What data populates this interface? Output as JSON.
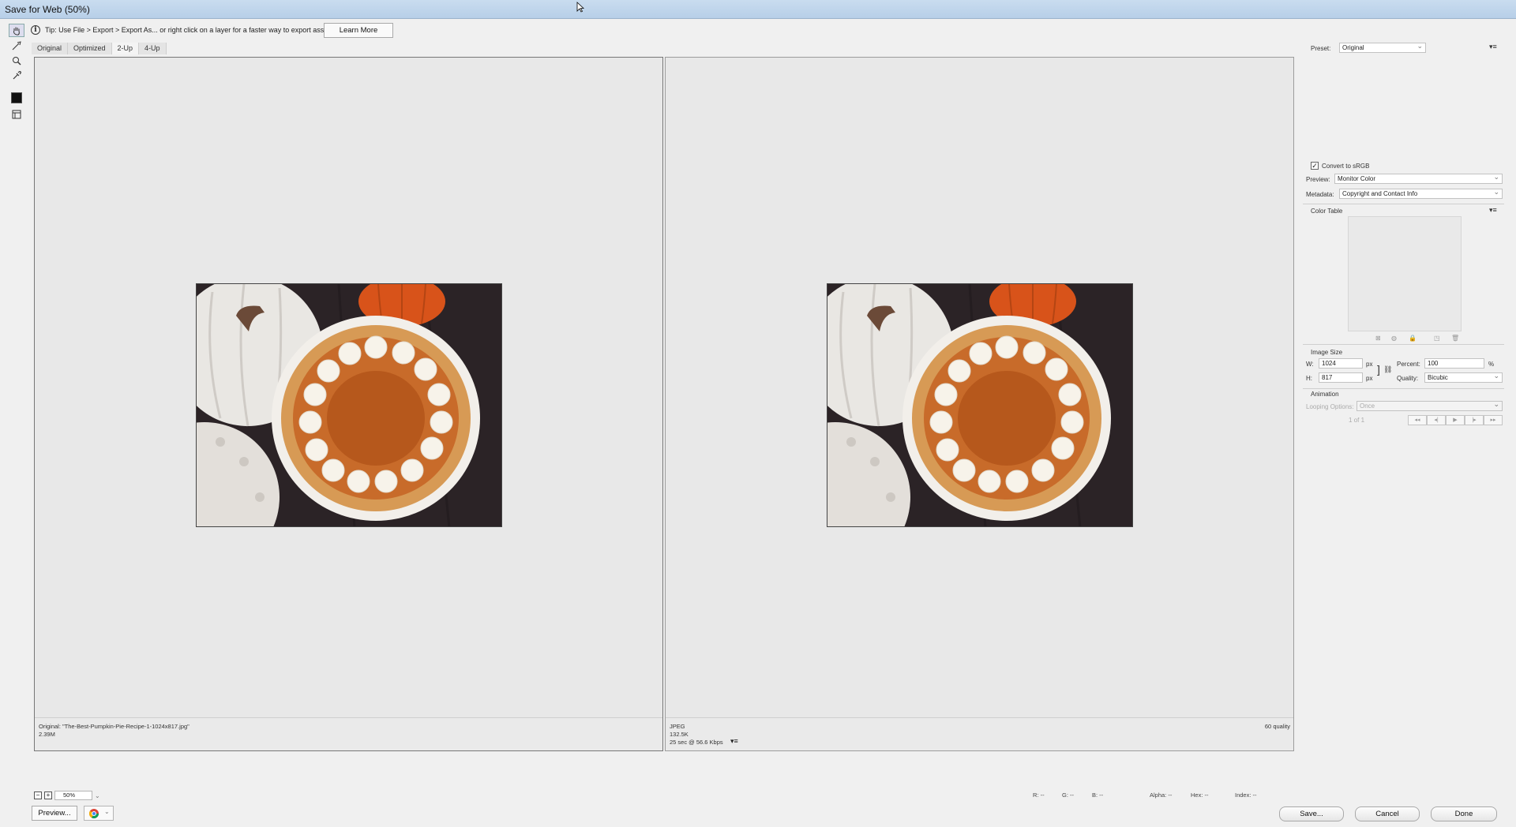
{
  "window": {
    "title": "Save for Web (50%)"
  },
  "tip": {
    "text": "Tip: Use File > Export > Export As... or right click on a layer for a faster way to export assets",
    "learn_more": "Learn More"
  },
  "tools": [
    {
      "name": "hand-tool-icon"
    },
    {
      "name": "slice-select-tool-icon"
    },
    {
      "name": "zoom-tool-icon"
    },
    {
      "name": "eyedropper-tool-icon"
    }
  ],
  "tabs": [
    "Original",
    "Optimized",
    "2-Up",
    "4-Up"
  ],
  "active_tab": "2-Up",
  "left_pane": {
    "line1": "Original: \"The-Best-Pumpkin-Pie-Recipe-1-1024x817.jpg\"",
    "line2": "2.39M"
  },
  "right_pane": {
    "line1": "JPEG",
    "line2": "132.5K",
    "line3": "25 sec @ 56.6 Kbps",
    "quality": "60 quality"
  },
  "zoom": {
    "value": "50%"
  },
  "readouts": {
    "r": "R: --",
    "g": "G: --",
    "b": "B: --",
    "alpha": "Alpha: --",
    "hex": "Hex: --",
    "index": "Index: --"
  },
  "buttons": {
    "preview": "Preview...",
    "save": "Save...",
    "cancel": "Cancel",
    "done": "Done"
  },
  "settings": {
    "preset_label": "Preset:",
    "preset_value": "Original",
    "convert_srgb": "Convert to sRGB",
    "convert_srgb_checked": true,
    "preview_label": "Preview:",
    "preview_value": "Monitor Color",
    "metadata_label": "Metadata:",
    "metadata_value": "Copyright and Contact Info"
  },
  "color_table": {
    "title": "Color Table"
  },
  "image_size": {
    "title": "Image Size",
    "w_label": "W:",
    "w_value": "1024",
    "h_label": "H:",
    "h_value": "817",
    "unit": "px",
    "percent_label": "Percent:",
    "percent_value": "100",
    "percent_unit": "%",
    "quality_label": "Quality:",
    "quality_value": "Bicubic"
  },
  "animation": {
    "title": "Animation",
    "looping_label": "Looping Options:",
    "looping_value": "Once",
    "frame_counter": "1 of 1"
  },
  "colors": {
    "title_bar": "#c3d7ec",
    "pane_bg": "#e8e8e8",
    "pie_filling": "#b6581c",
    "pie_crust": "#d79a55",
    "cream": "#f7f3ea",
    "background_wood": "#2b2326"
  }
}
